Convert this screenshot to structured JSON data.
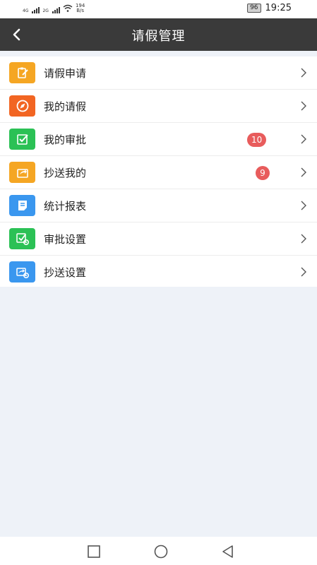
{
  "status_bar": {
    "net1": "4G",
    "net2": "2G",
    "speed_value": "194",
    "speed_unit": "B/s",
    "battery": "96",
    "time": "19:25"
  },
  "header": {
    "title": "请假管理",
    "back_icon": "chevron-left-icon"
  },
  "menu": {
    "items": [
      {
        "label": "请假申请",
        "icon": "clipboard-edit-icon",
        "color": "#f5a623",
        "badge": ""
      },
      {
        "label": "我的请假",
        "icon": "compass-icon",
        "color": "#f26522",
        "badge": ""
      },
      {
        "label": "我的审批",
        "icon": "check-square-icon",
        "color": "#2bc155",
        "badge": "10"
      },
      {
        "label": "抄送我的",
        "icon": "share-icon",
        "color": "#f5a623",
        "badge": "9"
      },
      {
        "label": "统计报表",
        "icon": "report-icon",
        "color": "#3a97ef",
        "badge": ""
      },
      {
        "label": "审批设置",
        "icon": "check-gear-icon",
        "color": "#2bc155",
        "badge": ""
      },
      {
        "label": "抄送设置",
        "icon": "share-gear-icon",
        "color": "#3a97ef",
        "badge": ""
      }
    ]
  },
  "nav_bar": {
    "recent": "square-icon",
    "home": "circle-icon",
    "back": "triangle-back-icon"
  }
}
